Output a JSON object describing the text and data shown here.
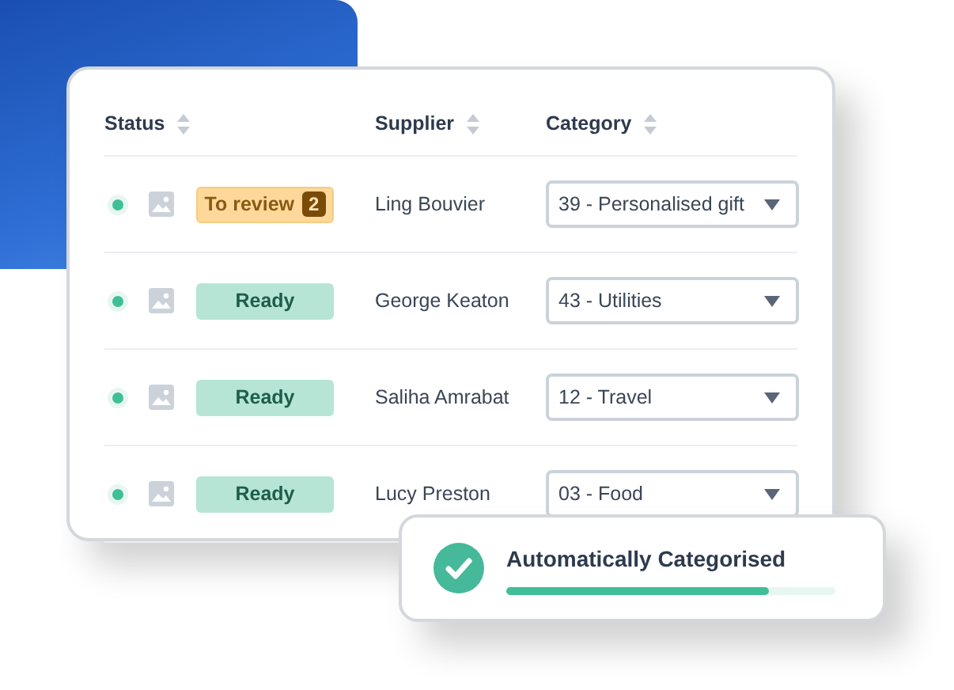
{
  "table": {
    "columns": [
      {
        "label": "Status",
        "sortable": true
      },
      {
        "label": "Supplier",
        "sortable": true
      },
      {
        "label": "Category",
        "sortable": true
      }
    ],
    "rows": [
      {
        "status": {
          "kind": "review",
          "label": "To review",
          "count": "2"
        },
        "supplier": "Ling Bouvier",
        "category": "39 - Personalised gift"
      },
      {
        "status": {
          "kind": "ready",
          "label": "Ready"
        },
        "supplier": "George Keaton",
        "category": "43 - Utilities"
      },
      {
        "status": {
          "kind": "ready",
          "label": "Ready"
        },
        "supplier": "Saliha Amrabat",
        "category": "12 - Travel"
      },
      {
        "status": {
          "kind": "ready",
          "label": "Ready"
        },
        "supplier": "Lucy Preston",
        "category": "03 - Food"
      }
    ]
  },
  "toast": {
    "title": "Automatically Categorised",
    "level": 0.8
  }
}
